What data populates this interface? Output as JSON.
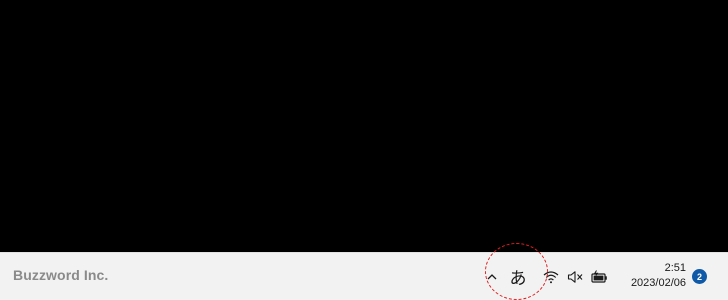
{
  "taskbar": {
    "brand": "Buzzword Inc.",
    "tray": {
      "overflow_icon": "chevron-up-icon",
      "ime_indicator": "あ",
      "wifi_icon": "wifi-icon",
      "volume_icon": "volume-muted-icon",
      "battery_icon": "battery-charging-icon"
    },
    "clock": {
      "time": "2:51",
      "date": "2023/02/06"
    },
    "notification_count": "2"
  },
  "annotation": {
    "type": "dashed-circle",
    "color": "#e11d1d",
    "target": "ime-indicator"
  },
  "colors": {
    "desktop": "#000000",
    "taskbar": "#f2f2f2",
    "badge": "#0f5aa8"
  }
}
